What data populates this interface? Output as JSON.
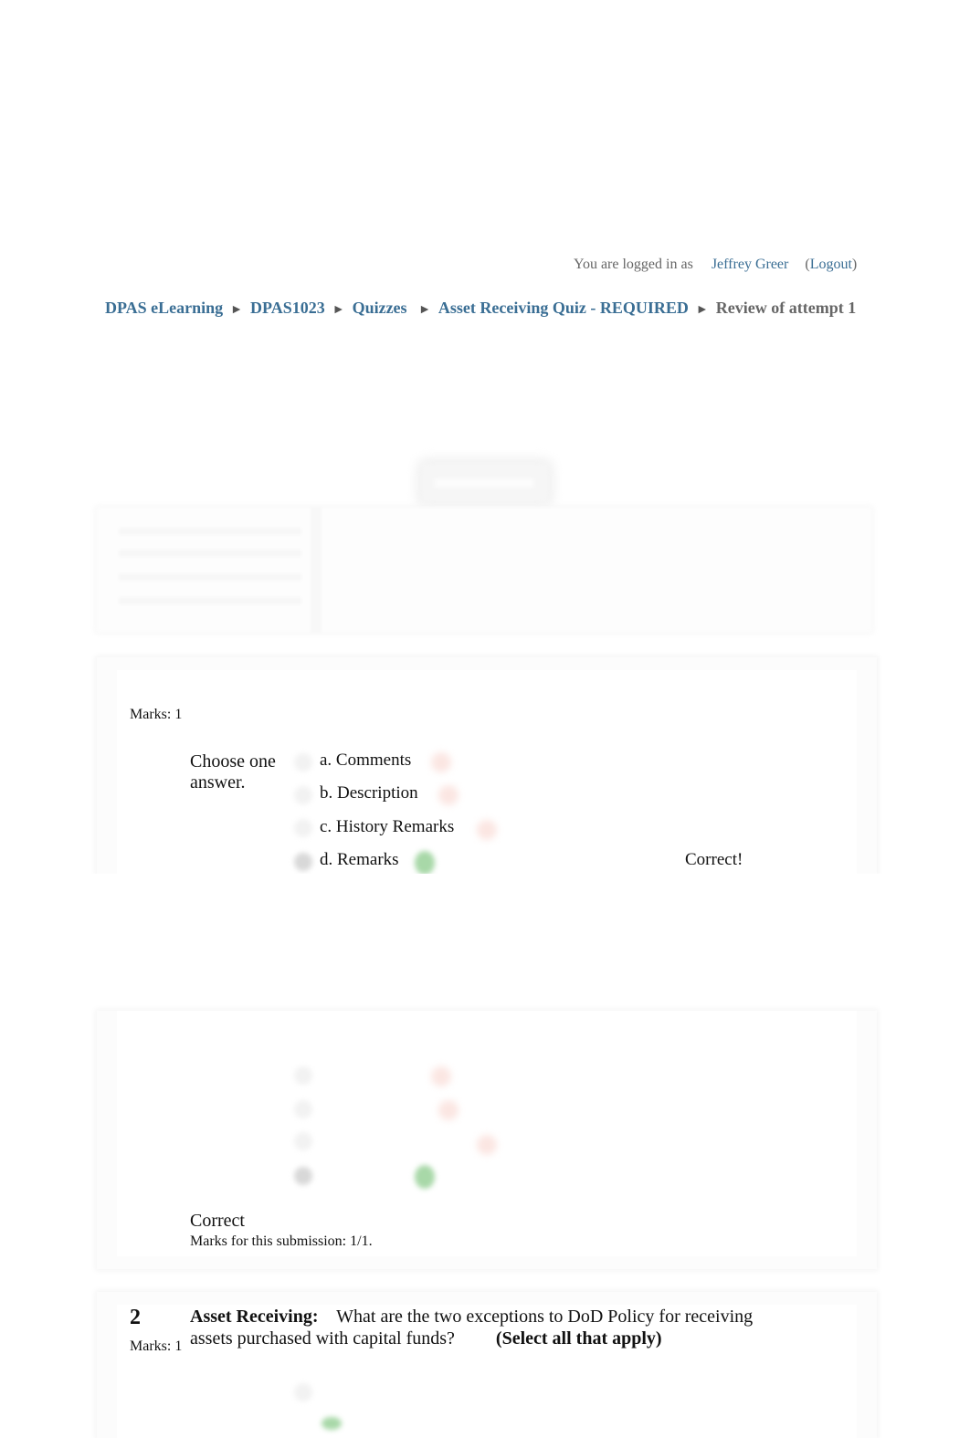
{
  "header": {
    "logged_in_prefix": "You are logged in as",
    "user_name": "Jeffrey Greer",
    "logout_open": "(",
    "logout_label": "Logout",
    "logout_close": ")"
  },
  "breadcrumb": {
    "separator": "►",
    "items": [
      {
        "label": "DPAS eLearning"
      },
      {
        "label": "DPAS1023"
      },
      {
        "label": "Quizzes"
      },
      {
        "label": "Asset Receiving Quiz - REQUIRED"
      }
    ],
    "current": "Review of attempt 1"
  },
  "colors": {
    "link": "#3a6e94",
    "muted_text": "#666666",
    "correct_green": "#a8d8a8",
    "incorrect_red": "#fbe6e2"
  },
  "questions": [
    {
      "marks_label": "Marks: 1",
      "instruction": "Choose one answer.",
      "options": [
        {
          "label": "a. Comments",
          "selected": false,
          "mark": "cross-icon"
        },
        {
          "label": "b. Description",
          "selected": false,
          "mark": "cross-icon"
        },
        {
          "label": "c. History Remarks",
          "selected": false,
          "mark": "cross-icon"
        },
        {
          "label": "d. Remarks",
          "selected": true,
          "mark": "check-icon",
          "feedback": "Correct!"
        }
      ],
      "grade": "Correct",
      "marks_for_submission": "Marks for this submission: 1/1."
    },
    {
      "number": "2",
      "marks_label": "Marks: 1",
      "topic": "Asset Receiving:",
      "text": "What are the two exceptions to DoD Policy for receiving assets purchased with capital funds?",
      "instruction": "(Select all that apply)"
    }
  ]
}
